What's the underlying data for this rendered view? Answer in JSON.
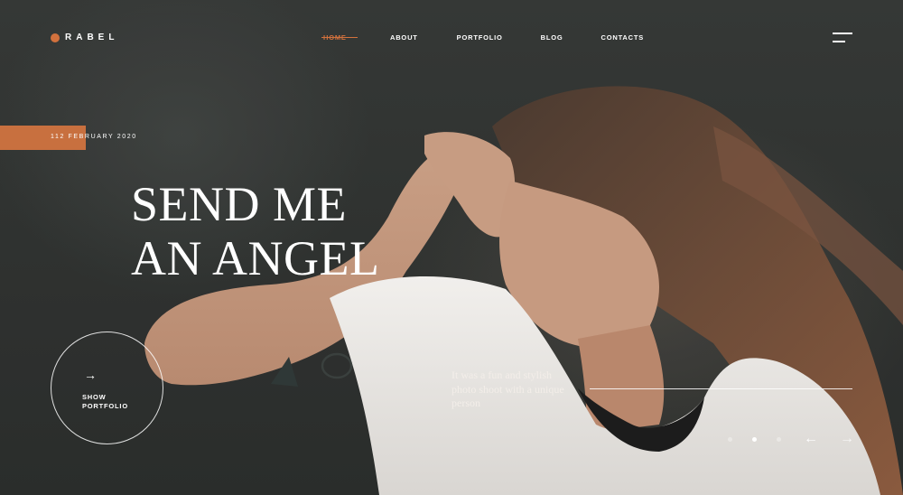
{
  "brand": {
    "name": "RABEL",
    "accent": "#d2713d"
  },
  "nav": {
    "home": "HOME",
    "about": "ABOUT",
    "portfolio": "PORTFOLIO",
    "blog": "BLOG",
    "contacts": "CONTACTS"
  },
  "menu_icon": "hamburger-icon",
  "hero": {
    "date": "112 FEBRUARY 2020",
    "title_line1": "SEND ME",
    "title_line2": "AN ANGEL",
    "cta_line1": "SHOW",
    "cta_line2": "PORTFOLIO",
    "cta_icon": "arrow-right-icon",
    "caption": "It was a fun and stylish photo shoot with a unique person"
  },
  "slider": {
    "slide_count": 3,
    "active_index": 1,
    "prev_icon": "arrow-left-icon",
    "next_icon": "arrow-right-icon"
  }
}
